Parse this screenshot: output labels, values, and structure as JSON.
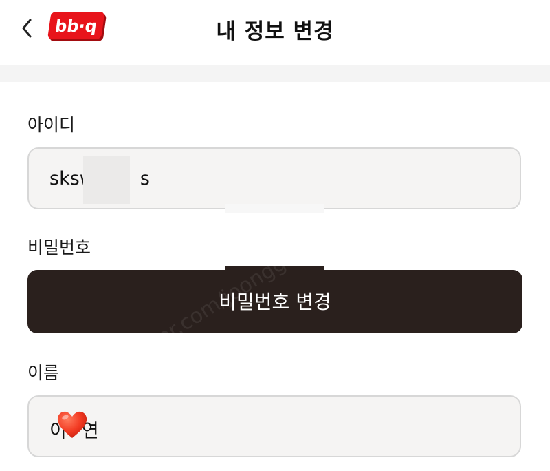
{
  "header": {
    "title": "내 정보 변경",
    "logo_text": "bb·q",
    "back_icon": "chevron-left-icon"
  },
  "form": {
    "id_label": "아이디",
    "id_value_start": "sksw",
    "id_value_end": "s",
    "password_label": "비밀번호",
    "password_button": "비밀번호 변경",
    "name_label": "이름",
    "name_value_start": "이",
    "name_value_end": "연"
  },
  "watermark": {
    "text": "cafe.naver.com/joonggonara"
  },
  "colors": {
    "logo_red": "#e8141b",
    "button_dark": "#2a201d",
    "input_bg": "#f5f4f3",
    "input_border": "#d7d7d7"
  }
}
